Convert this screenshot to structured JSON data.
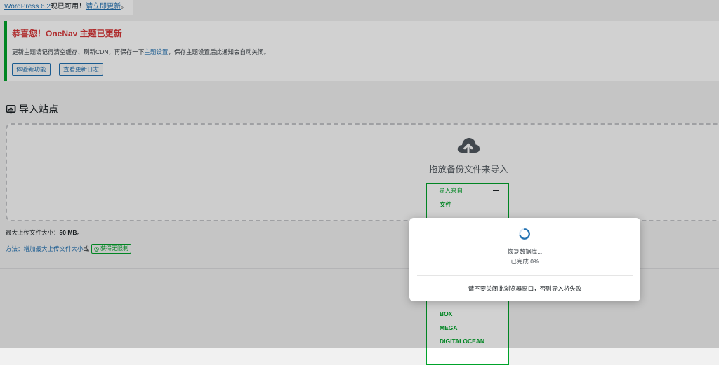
{
  "wp_update": {
    "version_link": "WordPress 6.2",
    "available_text": "现已可用！",
    "update_link": "请立即更新",
    "end": "。"
  },
  "theme_notice": {
    "title": "恭喜您！OneNav 主题已更新",
    "desc_before": "更新主题请记得清空缓存、刷新CDN，再保存一下",
    "desc_link": "主题设置",
    "desc_after": "，保存主题设置后此通知会自动关闭。",
    "btn_new_features": "体验新功能",
    "btn_changelog": "查看更新日志"
  },
  "import": {
    "title": "导入站点",
    "title_icon": "import-box-icon",
    "drop_label": "拖放备份文件来导入",
    "upload_icon": "cloud-upload-icon",
    "source_header": "导入来自",
    "sources_top": [
      "文件"
    ],
    "sources_bottom": [
      "BOX",
      "MEGA",
      "DIGITALOCEAN"
    ],
    "max_upload_label": "最大上传文件大小：",
    "max_upload_value": "50 MB",
    "max_upload_end": "。",
    "method_link": "方法：增加最大上传文件大小",
    "or_text": "或",
    "unlimited_tag": "获得无限制"
  },
  "modal": {
    "status_line1": "恢复数据库...",
    "status_line2": "已完成 0%",
    "warning": "请不要关闭此浏览器窗口，否则导入将失败"
  },
  "colors": {
    "accent": "#2271b1",
    "success": "#00a32a",
    "error": "#d63638"
  }
}
